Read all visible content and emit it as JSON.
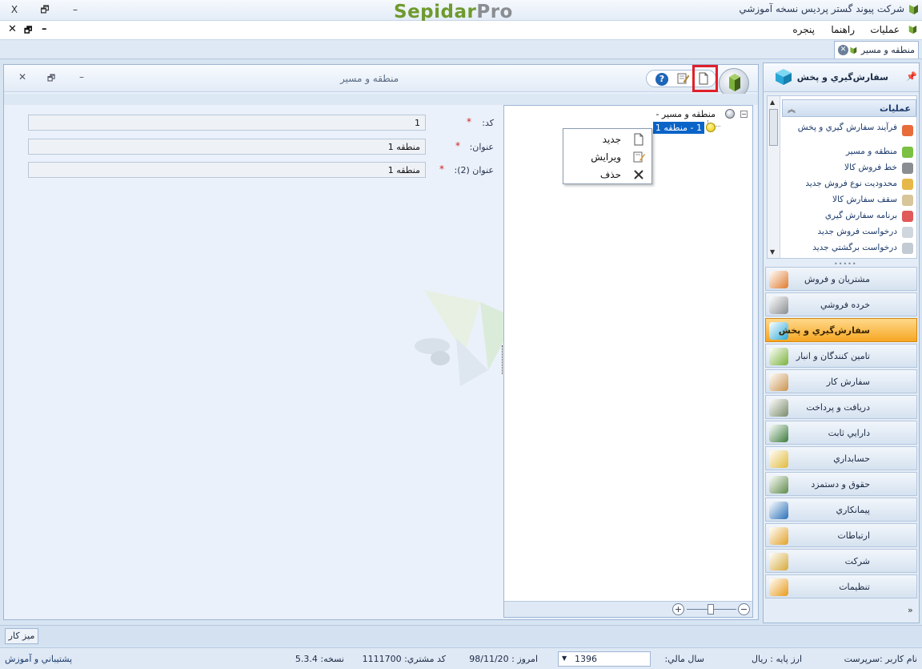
{
  "window": {
    "title": "شرکت پیوند گستر پردیس نسخه آموزشي",
    "brand_part1": "Sepidar",
    "brand_part2": "Pro",
    "close_glyph": "X",
    "restore_glyph": "🗗",
    "minimize_glyph": "–"
  },
  "menu": {
    "items": [
      "عمليات",
      "راهنما",
      "پنجره"
    ],
    "child_close": "✕",
    "child_restore": "🗗",
    "child_minimize": "–"
  },
  "tabs": [
    {
      "label": "منطقه و مسير"
    }
  ],
  "form": {
    "title": "منطقه و مسير",
    "fields": [
      {
        "label": "کد:",
        "value": "1",
        "required": "*"
      },
      {
        "label": "عنوان:",
        "value": "منطقه 1",
        "required": "*"
      },
      {
        "label": "عنوان (2):",
        "value": "منطقه 1",
        "required": "*"
      }
    ],
    "help_glyph": "?"
  },
  "tree": {
    "root_label": "منطقه و مسير  -",
    "selected_label": "1  -  منطقه 1"
  },
  "context_menu": {
    "items": [
      "جديد",
      "ويرايش",
      "حذف"
    ]
  },
  "nav": {
    "header_title": "سفارش‌گيري و پخش",
    "ops_title": "عمليات",
    "ops_items": [
      "فرآيند سفارش گيري و پخش",
      "منطقه و مسير",
      "خط فروش کالا",
      "محدوديت نوع فروش جديد",
      "سقف سفارش کالا",
      "برنامه سفارش گيري",
      "درخواست فروش جديد",
      "درخواست برگشتي جديد"
    ],
    "buttons": [
      {
        "label": "مشتريان و فروش",
        "color": "#e07b2e"
      },
      {
        "label": "خرده فروشي",
        "color": "#8a8d91"
      },
      {
        "label": "سفارش‌گيري و پخش",
        "color": "#29a8d8"
      },
      {
        "label": "تامين کنندگان و انبار",
        "color": "#7bb13a"
      },
      {
        "label": "سفارش کار",
        "color": "#c9934e"
      },
      {
        "label": "دريافت و پرداخت",
        "color": "#7a8a6a"
      },
      {
        "label": "دارايي ثابت",
        "color": "#3b7b3b"
      },
      {
        "label": "حسابداري",
        "color": "#e1b93a"
      },
      {
        "label": "حقوق و دستمزد",
        "color": "#5f8a4a"
      },
      {
        "label": "پيمانکاري",
        "color": "#2a6fb8"
      },
      {
        "label": "ارتباطات",
        "color": "#e2a22a"
      },
      {
        "label": "شرکت",
        "color": "#d6a93a"
      },
      {
        "label": "تنظيمات",
        "color": "#e89a1a"
      }
    ],
    "active_index": 2
  },
  "taskbar": {
    "desk_label": "ميز کار"
  },
  "status": {
    "user": "نام کاربر :سرپرست",
    "currency": "ارز پايه :  ريال",
    "fiscal_year_label": "سال مالي:",
    "fiscal_year": "1396",
    "today": "امروز :    98/11/20",
    "customer_code": "کد مشتري:   1111700",
    "version": "نسخه:   5.3.4",
    "support": "پشتيباني و آموزش"
  }
}
